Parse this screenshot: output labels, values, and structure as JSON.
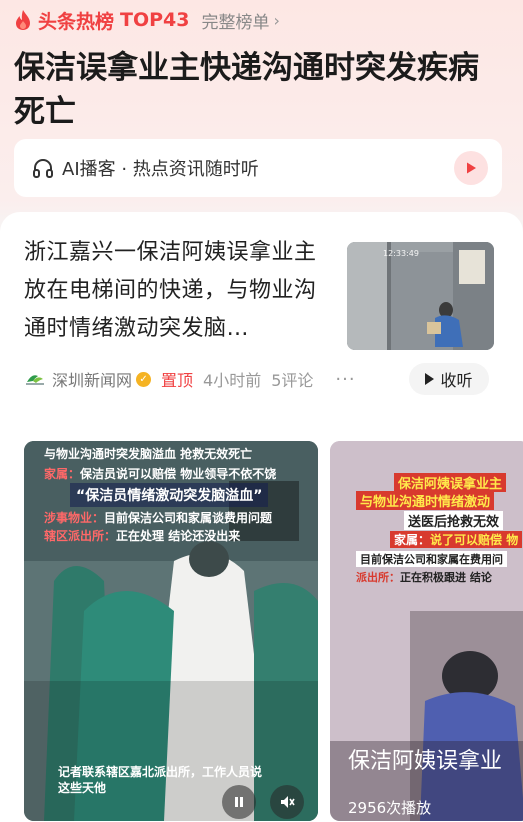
{
  "header": {
    "brand": "头条热榜",
    "rank": "TOP43",
    "full_list": "完整榜单",
    "headline": "保洁误拿业主快递沟通时突发疾病死亡"
  },
  "podcast": {
    "label": "AI播客 · 热点资讯随时听"
  },
  "article": {
    "title": "浙江嘉兴一保洁阿姨误拿业主放在电梯间的快递，与物业沟通时情绪激动突发脑…",
    "source": "深圳新闻网",
    "pinned": "置顶",
    "time": "4小时前",
    "comments": "5评论",
    "more": "···",
    "collect": "收听"
  },
  "thumbnail": {
    "timestamp": "12:33:49"
  },
  "video1": {
    "line1": "与物业沟通时突发脑溢血 抢救无效死亡",
    "line2_label": "家属：",
    "line2": "保洁员说可以赔偿 物业领导不依不饶",
    "quote": "“保洁员情绪激动突发脑溢血”",
    "line4_label": "涉事物业：",
    "line4": "目前保洁公司和家属谈费用问题",
    "line5_label": "辖区派出所：",
    "line5": "正在处理 结论还没出来",
    "caption1": "记者联系辖区嘉北派出所，工作人员说",
    "caption2": "这些天他"
  },
  "video2": {
    "line1": "保洁阿姨误拿业主",
    "line2": "与物业沟通时情绪激动",
    "line3": "送医后抢救无效",
    "line4_label": "家属：",
    "line4": "说了可以赔偿 物",
    "line5": "目前保洁公司和家属在费用问",
    "line6_label": "派出所：",
    "line6": "正在积极跟进 结论",
    "big_title": "保洁阿姨误拿业",
    "plays": "2956次播放"
  },
  "colors": {
    "accent": "#f04142",
    "brand_yellow": "#f7d13a"
  }
}
